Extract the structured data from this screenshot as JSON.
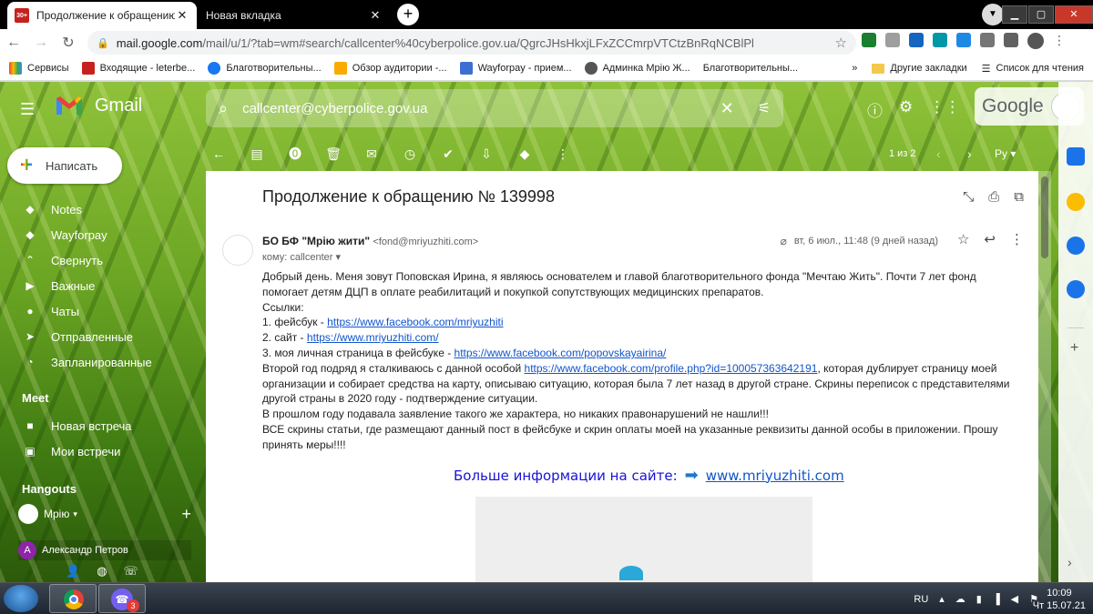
{
  "browser": {
    "tabs": [
      {
        "title": "Продолжение к обращению №",
        "favicon": "30+"
      },
      {
        "title": "Новая вкладка"
      }
    ],
    "url_domain": "mail.google.com",
    "url_path": "/mail/u/1/?tab=wm#search/callcenter%40cyberpolice.gov.ua/QgrcJHsHkxjLFxZCCmrpVTCtzBnRqNCBlPl",
    "bookmarks": [
      "Сервисы",
      "Входящие - leterbe...",
      "Благотворительны...",
      "Обзор аудитории -...",
      "Wayforpay - прием...",
      "Админка Мрію Ж...",
      "Благотворительны..."
    ],
    "bookmarks_more": "»",
    "other_bookmarks": "Другие закладки",
    "reading_list": "Список для чтения"
  },
  "gmail": {
    "product": "Gmail",
    "search_query": "callcenter@cyberpolice.gov.ua",
    "google_label": "Google",
    "compose_label": "Написать",
    "nav_items": [
      {
        "label": "Notes",
        "icon": "label-icon"
      },
      {
        "label": "Wayforpay",
        "icon": "label-icon"
      },
      {
        "label": "Свернуть",
        "icon": "collapse-icon"
      },
      {
        "label": "Важные",
        "icon": "important-icon"
      },
      {
        "label": "Чаты",
        "icon": "chat-icon"
      },
      {
        "label": "Отправленные",
        "icon": "send-icon"
      },
      {
        "label": "Запланированные",
        "icon": "scheduled-icon"
      }
    ],
    "meet": {
      "title": "Meet",
      "items": [
        {
          "label": "Новая встреча",
          "icon": "video-icon"
        },
        {
          "label": "Мои встречи",
          "icon": "calendar-icon"
        }
      ]
    },
    "hangouts": {
      "title": "Hangouts",
      "user": "Мрію",
      "contact_initial": "А",
      "contact_name": "Александр Петров"
    },
    "pager": {
      "count": "1 из 2",
      "lang": "Ру"
    },
    "message": {
      "subject": "Продолжение к обращению № 139998",
      "sender_name": "БО БФ \"Мрію жити\"",
      "sender_email": "<fond@mriyuzhiti.com>",
      "to": "кому: callcenter",
      "date": "вт, 6 июл., 11:48 (9 дней назад)",
      "body": {
        "p1": "Добрый день. Меня зовут Поповская Ирина, я являюсь основателем и главой благотворительного фонда \"Мечтаю Жить\". Почти 7 лет фонд помогает детям ДЦП в оплате реабилитаций и покупкой сопутствующих медицинских препаратов.",
        "links_title": "Ссылки:",
        "l1_prefix": "1. фейсбук - ",
        "l1_url": "https://www.facebook.com/mriyuzhiti",
        "l2_prefix": "2. сайт - ",
        "l2_url": "https://www.mriyuzhiti.com/",
        "l3_prefix": "3. моя личная страница в фейсбуке - ",
        "l3_url": "https://www.facebook.com/popovskayairina/",
        "p2_prefix": "Второй год подряд я сталкиваюсь с данной особой ",
        "p2_url": "https://www.facebook.com/profile.php?id=100057363642191",
        "p2_suffix": ", которая дублирует страницу моей организации и собирает средства на карту, описываю ситуацию, которая была 7 лет назад в другой стране. Скрины переписок с представителями другой страны в 2020 году - подтверждение ситуации.",
        "p3": "В прошлом году подавала заявление такого же характера, но никаких правонарушений не нашли!!!",
        "p4": "ВСЕ скрины статьи, где размещают данный пост в фейсбуке и скрин оплаты моей на указанные реквизиты данной особы в приложении. Прошу принять меры!!!!"
      },
      "promo_text": "Больше информации на сайте:",
      "promo_link": "www.mriyuzhiti.com"
    }
  },
  "taskbar": {
    "viber_badge": "3",
    "lang": "RU",
    "time": "10:09",
    "date": "Чт 15.07.21"
  }
}
